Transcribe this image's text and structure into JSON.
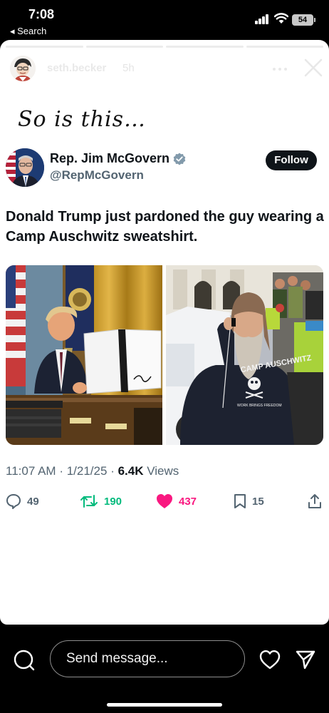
{
  "status_bar": {
    "time": "7:08",
    "back_label": "◂ Search",
    "battery": "54"
  },
  "story": {
    "username": "seth.becker",
    "age": "5h",
    "caption": "So is this…",
    "progress_segments": 4,
    "progress_done": 4
  },
  "tweet": {
    "display_name": "Rep. Jim McGovern",
    "handle": "@RepMcGovern",
    "follow_label": "Follow",
    "text": "Donald Trump just pardoned the guy wearing a Camp Auschwitz sweatshirt.",
    "time": "11:07 AM",
    "date": "1/21/25",
    "views": "6.4K",
    "views_label": "Views",
    "separator": "·",
    "replies": "49",
    "reposts": "190",
    "likes": "437",
    "bookmarks": "15",
    "sweatshirt_print": "CAMP AUSCHWITZ",
    "sweatshirt_print_small": "WORK BRINGS FREEDOM"
  },
  "composer": {
    "placeholder": "Send message..."
  },
  "colors": {
    "repost_green": "#00ba7c",
    "like_pink": "#f91880",
    "verified_blue": "#829aab",
    "muted_text": "#536471"
  },
  "icons": [
    "signal-icon",
    "wifi-icon",
    "more-icon",
    "close-icon",
    "verified-icon",
    "reply-icon",
    "repost-icon",
    "like-icon",
    "bookmark-icon",
    "share-icon",
    "camera-icon",
    "heart-icon",
    "send-icon"
  ]
}
